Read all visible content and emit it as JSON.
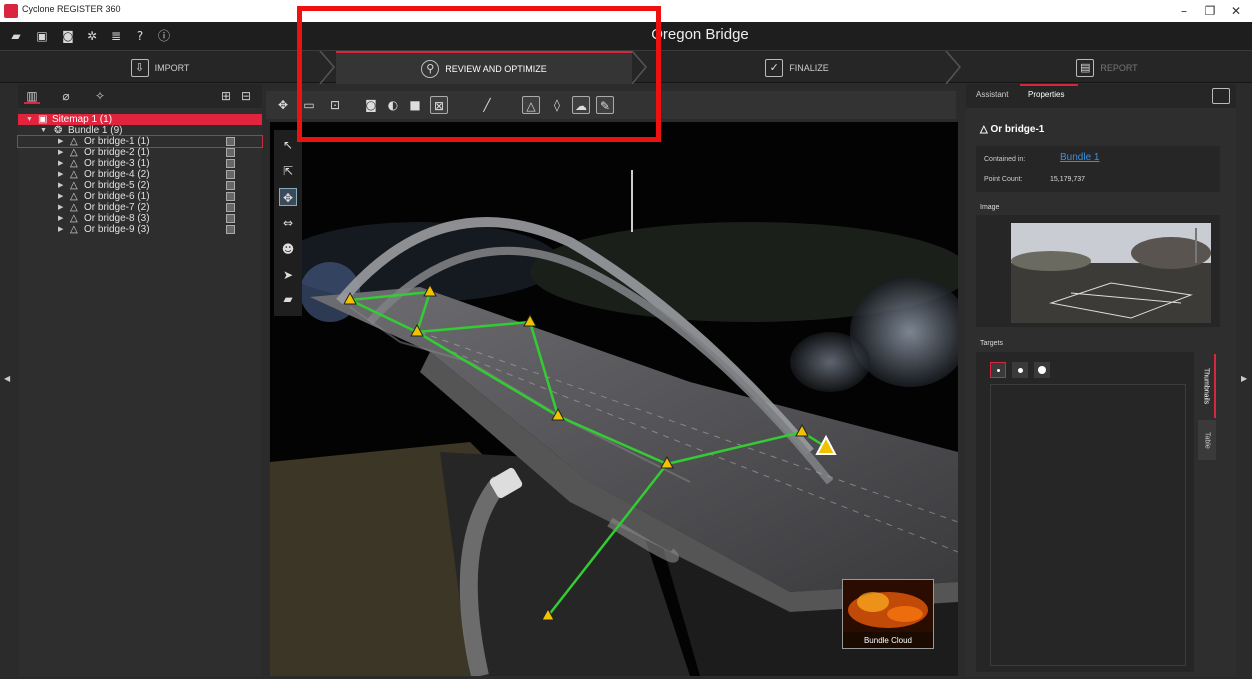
{
  "window": {
    "title": "Cyclone REGISTER 360"
  },
  "project": {
    "title": "Oregon Bridge"
  },
  "workflow": {
    "tabs": [
      {
        "label": "IMPORT"
      },
      {
        "label": "REVIEW AND OPTIMIZE"
      },
      {
        "label": "FINALIZE"
      },
      {
        "label": "REPORT"
      }
    ]
  },
  "tree": {
    "sitemap": "Sitemap 1 (1)",
    "bundle": "Bundle 1 (9)",
    "setups": [
      "Or bridge-1 (1)",
      "Or bridge-2 (1)",
      "Or bridge-3 (1)",
      "Or bridge-4 (2)",
      "Or bridge-5 (2)",
      "Or bridge-6 (1)",
      "Or bridge-7 (2)",
      "Or bridge-8 (3)",
      "Or bridge-9 (3)"
    ]
  },
  "viewport": {
    "bundle_thumb_label": "Bundle Cloud"
  },
  "right_panel": {
    "tab_assistant": "Assistant",
    "tab_properties": "Properties",
    "object_title": "Or bridge-1",
    "contained_in_label": "Contained in:",
    "contained_in_value": "Bundle 1",
    "point_count_label": "Point Count:",
    "point_count_value": "15,179,737",
    "image_label": "Image",
    "targets_label": "Targets",
    "vtab_thumbnails": "Thumbnails",
    "vtab_table": "Table"
  },
  "colors": {
    "accent": "#d7263d",
    "highlight": "#ee1111",
    "link": "#3a8fd8",
    "link_lines": "#33cc33",
    "target_marker": "#f2c200"
  }
}
